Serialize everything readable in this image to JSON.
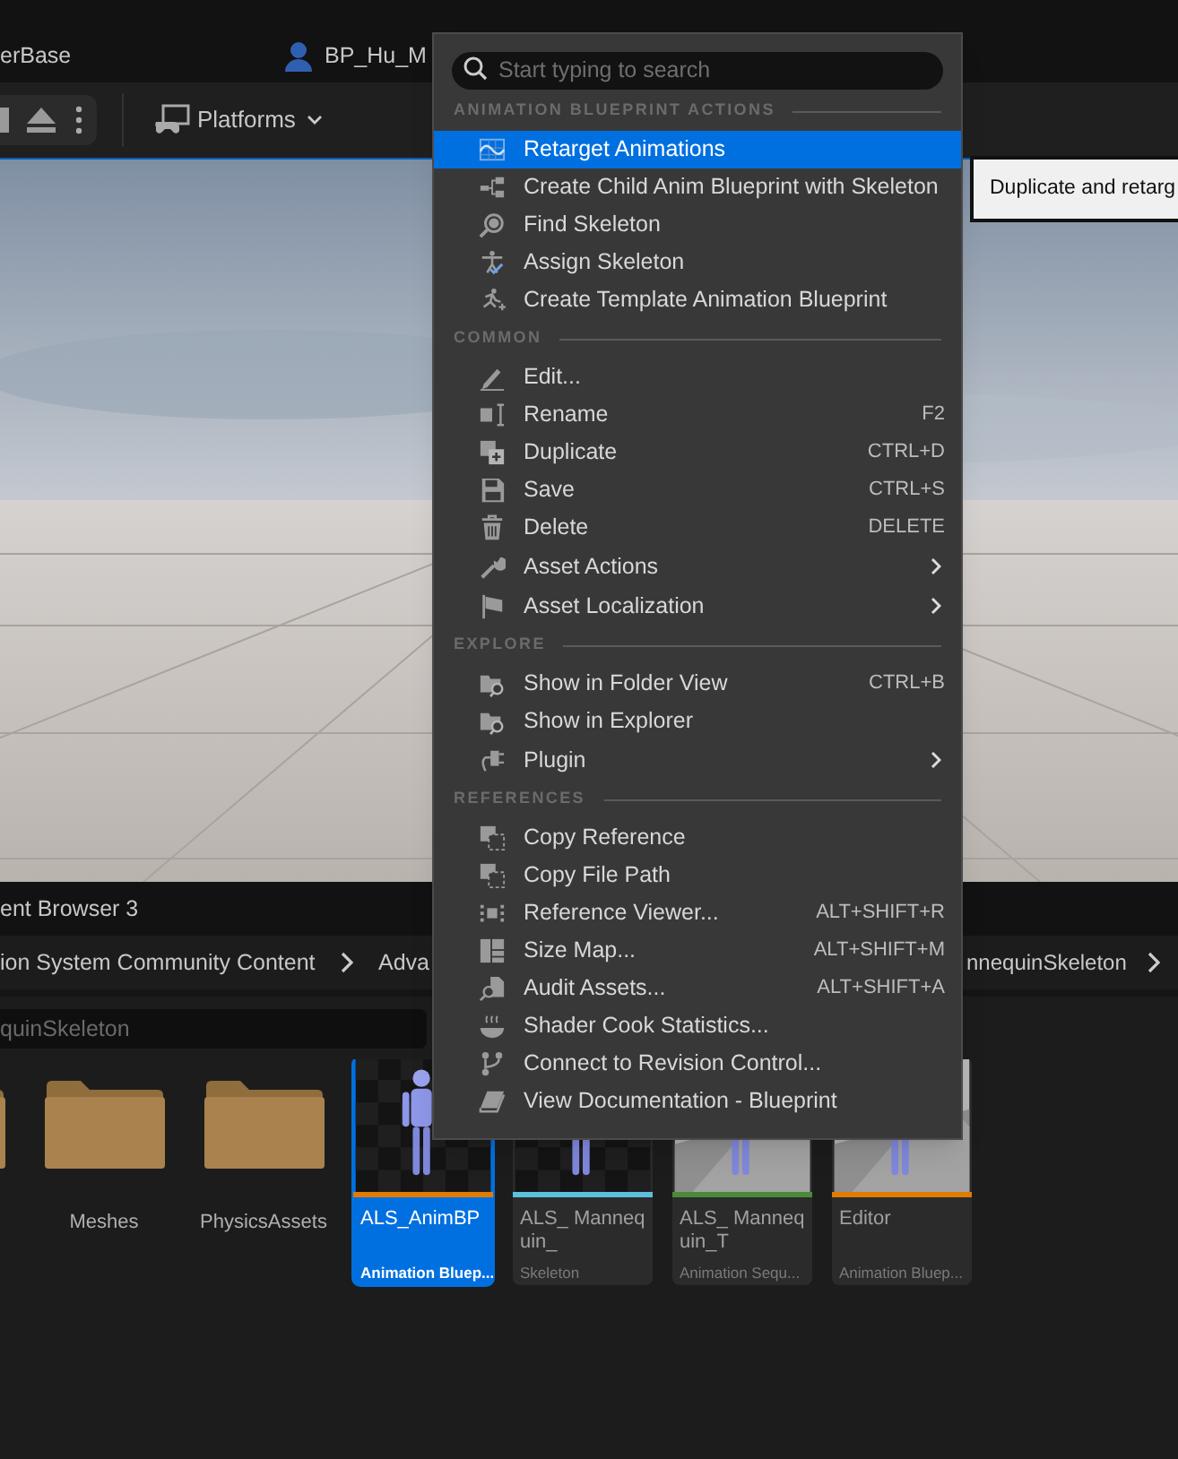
{
  "editor_tabs": [
    {
      "label": "erBase",
      "kind": "plain"
    },
    {
      "label": "BP_Hu_M",
      "kind": "blueprint"
    }
  ],
  "toolbar": {
    "platforms_label": "Platforms"
  },
  "context_menu": {
    "search_placeholder": "Start typing to search",
    "sections": [
      {
        "title": "ANIMATION BLUEPRINT ACTIONS",
        "items": [
          {
            "label": "Retarget Animations",
            "selected": true,
            "submenu": false
          },
          {
            "label": "Create Child Anim Blueprint with Skeleton",
            "selected": false,
            "submenu": false
          },
          {
            "label": "Find Skeleton",
            "selected": false,
            "submenu": false
          },
          {
            "label": "Assign Skeleton",
            "selected": false,
            "submenu": false
          },
          {
            "label": "Create Template Animation Blueprint",
            "selected": false,
            "submenu": false
          }
        ]
      },
      {
        "title": "COMMON",
        "items": [
          {
            "label": "Edit...",
            "selected": false,
            "submenu": false
          },
          {
            "label": "Rename",
            "shortcut": "F2",
            "selected": false,
            "submenu": false
          },
          {
            "label": "Duplicate",
            "shortcut": "CTRL+D",
            "selected": false,
            "submenu": false
          },
          {
            "label": "Save",
            "shortcut": "CTRL+S",
            "selected": false,
            "submenu": false
          },
          {
            "label": "Delete",
            "shortcut": "DELETE",
            "selected": false,
            "submenu": false
          },
          {
            "label": "Asset Actions",
            "selected": false,
            "submenu": true
          },
          {
            "label": "Asset Localization",
            "selected": false,
            "submenu": true
          }
        ]
      },
      {
        "title": "EXPLORE",
        "items": [
          {
            "label": "Show in Folder View",
            "shortcut": "CTRL+B",
            "selected": false,
            "submenu": false
          },
          {
            "label": "Show in Explorer",
            "selected": false,
            "submenu": false
          },
          {
            "label": "Plugin",
            "selected": false,
            "submenu": true
          }
        ]
      },
      {
        "title": "REFERENCES",
        "items": [
          {
            "label": "Copy Reference",
            "selected": false,
            "submenu": false
          },
          {
            "label": "Copy File Path",
            "selected": false,
            "submenu": false
          },
          {
            "label": "Reference Viewer...",
            "shortcut": "ALT+SHIFT+R",
            "selected": false,
            "submenu": false
          },
          {
            "label": "Size Map...",
            "shortcut": "ALT+SHIFT+M",
            "selected": false,
            "submenu": false
          },
          {
            "label": "Audit Assets...",
            "shortcut": "ALT+SHIFT+A",
            "selected": false,
            "submenu": false
          },
          {
            "label": "Shader Cook Statistics...",
            "selected": false,
            "submenu": false
          },
          {
            "label": "Connect to Revision Control...",
            "selected": false,
            "submenu": false
          },
          {
            "label": "View Documentation - Blueprint",
            "selected": false,
            "submenu": false
          }
        ]
      }
    ]
  },
  "tooltip": {
    "text": "Duplicate and retarg"
  },
  "content_browser": {
    "tab_label": "ent Browser 3",
    "breadcrumbs": [
      "ion System Community Content",
      "Adva",
      "nnequinSkeleton"
    ],
    "search_value": "quinSkeleton",
    "items": [
      {
        "kind": "folder",
        "selected": false
      },
      {
        "kind": "folder",
        "name": "Meshes",
        "selected": false
      },
      {
        "kind": "folder",
        "name": "PhysicsAssets",
        "selected": false
      },
      {
        "kind": "asset",
        "name": "ALS_AnimBP",
        "type": "Animation Bluep...",
        "color": "#e07b00",
        "selected": true
      },
      {
        "kind": "asset",
        "name": "ALS_ Mannequin_",
        "type": "Skeleton",
        "color": "#5bc0de",
        "selected": false
      },
      {
        "kind": "asset",
        "name": "ALS_ Mannequin_T",
        "type": "Animation Sequ...",
        "color": "#4a8a3a",
        "selected": false
      },
      {
        "kind": "asset",
        "name": "Editor",
        "type": "Animation Bluep...",
        "color": "#e07b00",
        "selected": false
      }
    ]
  }
}
